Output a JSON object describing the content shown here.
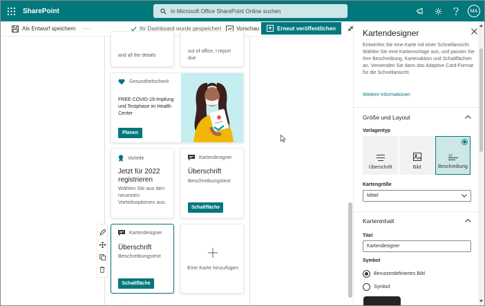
{
  "suite": {
    "brand": "SharePoint",
    "search_placeholder": "In Microsoft Office SharePoint Online suchen",
    "avatar_initials": "MA"
  },
  "command_bar": {
    "draft_label": "Als Entwurf speichern",
    "more_label": "···",
    "saved_status": "Ihr Dashboard wurde gespeichert",
    "preview_label": "Vorschau",
    "publish_label": "Erneut veröffentlichen"
  },
  "cards": {
    "partial_left": "and all the details",
    "partial_right_1": "out of office, I report",
    "partial_right_2": "due",
    "health": {
      "header": "Gesundheitscheck",
      "text": "FREE COVID-19-Impfung und Testphase im Health Center",
      "button": "Planen"
    },
    "benefits": {
      "header": "Vorteile",
      "title": "Jetzt für 2022 registrieren",
      "text": "Wählen Sie aus den neuesten Vorteilsoptionen aus."
    },
    "designer_1": {
      "header": "Kartendesigner",
      "title": "Überschrift",
      "text": "Beschreibungstext",
      "button": "Schaltfläche"
    },
    "designer_2": {
      "header": "Kartendesigner",
      "title": "Überschrift",
      "text": "Beschreibungstext",
      "button": "Schaltfläche"
    },
    "add_card": "Eine Karte hinzufügen"
  },
  "panel": {
    "title": "Kartendesigner",
    "intro": "Entwerfen Sie eine Karte mit einer Schnellansicht. Wählen Sie eine Kartenvorlage aus, und passen Sie Ihre Beschreibung, Kartenaktion und Schaltflächen an. Verwenden Sie dann das Adaptive Card-Format für die Schnellansicht.",
    "more_info": "Weitere Informationen",
    "size_layout": {
      "title": "Größe und Layout",
      "template_label": "Vorlagentyp",
      "templates": [
        "Überschrift",
        "Bild",
        "Beschreibung"
      ],
      "selected_template": "Beschreibung",
      "card_size_label": "Kartengröße",
      "card_size_value": "Mittel"
    },
    "content": {
      "title": "Karteninhalt",
      "title_label": "Titel",
      "title_value": "Kartendesigner",
      "symbol_label": "Symbol",
      "symbol_options": [
        "Benutzerdefiniertes Bild",
        "Symbol"
      ],
      "symbol_selected": "Benutzerdefiniertes Bild"
    }
  },
  "colors": {
    "brand": "#03787c",
    "search_bg": "#cde6e7",
    "illustration_bg": "#c4eef0"
  }
}
